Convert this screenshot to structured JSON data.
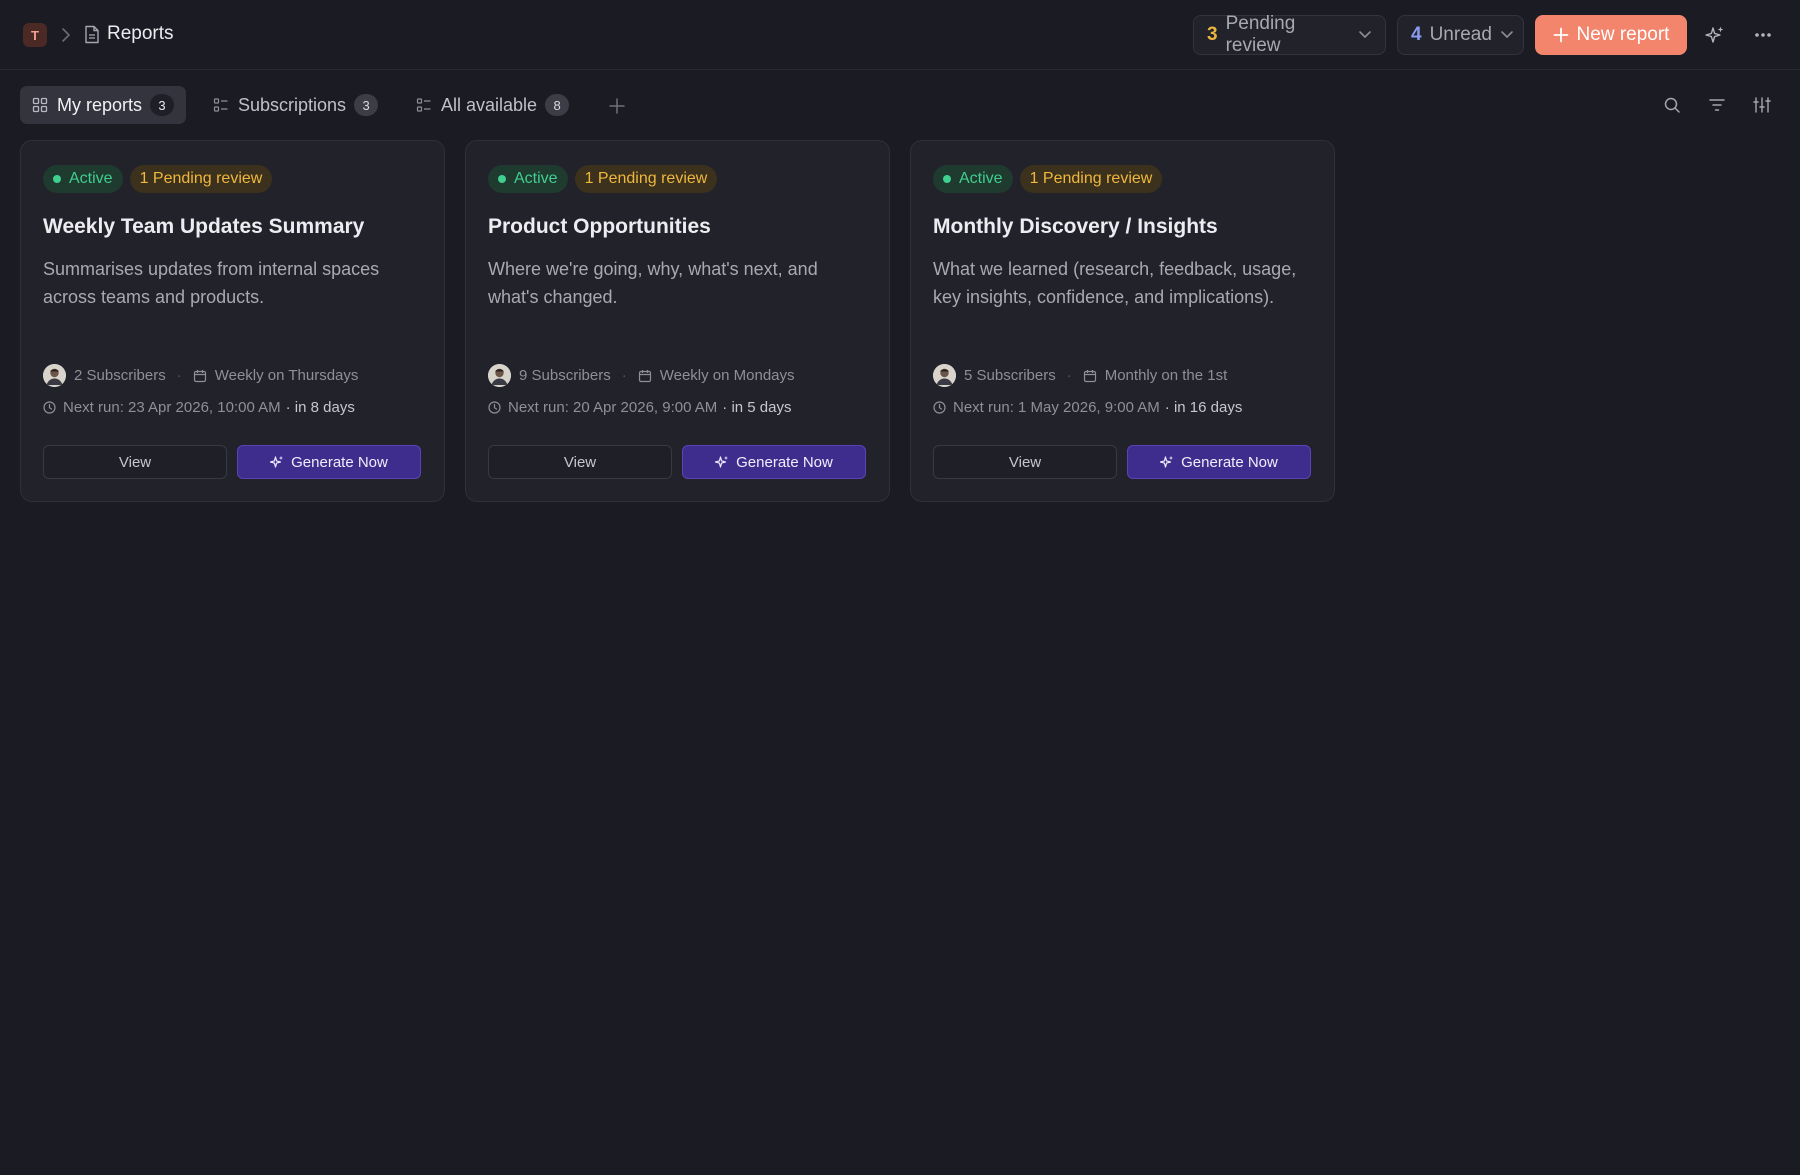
{
  "breadcrumb": {
    "workspace_initial": "T",
    "page_title": "Reports"
  },
  "header": {
    "pending": {
      "count": "3",
      "label": "Pending review"
    },
    "unread": {
      "count": "4",
      "label": "Unread"
    },
    "new_report_label": "New report"
  },
  "tabs": [
    {
      "label": "My reports",
      "count": "3"
    },
    {
      "label": "Subscriptions",
      "count": "3"
    },
    {
      "label": "All available",
      "count": "8"
    }
  ],
  "cards": [
    {
      "status": "Active",
      "pending": "1 Pending review",
      "title": "Weekly Team Updates Summary",
      "description": "Summarises updates from internal spaces across teams and products.",
      "subscribers": "2 Subscribers",
      "schedule": "Weekly on Thursdays",
      "next_run": "Next run: 23 Apr 2026, 10:00 AM",
      "relative": "· in 8 days",
      "view_label": "View",
      "generate_label": "Generate Now"
    },
    {
      "status": "Active",
      "pending": "1 Pending review",
      "title": "Product Opportunities",
      "description": "Where we're going, why, what's next, and what's changed.",
      "subscribers": "9 Subscribers",
      "schedule": "Weekly on Mondays",
      "next_run": "Next run: 20 Apr 2026, 9:00 AM",
      "relative": "· in 5 days",
      "view_label": "View",
      "generate_label": "Generate Now"
    },
    {
      "status": "Active",
      "pending": "1 Pending review",
      "title": "Monthly Discovery / Insights",
      "description": "What we learned (research, feedback, usage, key insights, confidence, and implications).",
      "subscribers": "5 Subscribers",
      "schedule": "Monthly on the 1st",
      "next_run": "Next run: 1 May 2026, 9:00 AM",
      "relative": "· in 16 days",
      "view_label": "View",
      "generate_label": "Generate Now"
    }
  ],
  "colors": {
    "background": "#1b1b23",
    "accent_new_report": "#f3856d",
    "generate_button": "#3f2d8e",
    "status_active": "#3fcf8e",
    "status_pending": "#f0b73c"
  },
  "icons": {
    "breadcrumb_separator": "chevron-right-icon",
    "page": "document-icon",
    "dropdown": "chevron-down-icon",
    "new_report": "plus-icon",
    "ai": "sparkle-icon",
    "more": "more-horizontal-icon",
    "tab_my_reports": "grid-icon",
    "tab_lists": "list-icon",
    "add_tab": "plus-icon",
    "search": "search-icon",
    "filter": "filter-icon",
    "display_settings": "sliders-icon",
    "subscribers": "avatar",
    "schedule": "calendar-icon",
    "next_run": "clock-icon"
  }
}
